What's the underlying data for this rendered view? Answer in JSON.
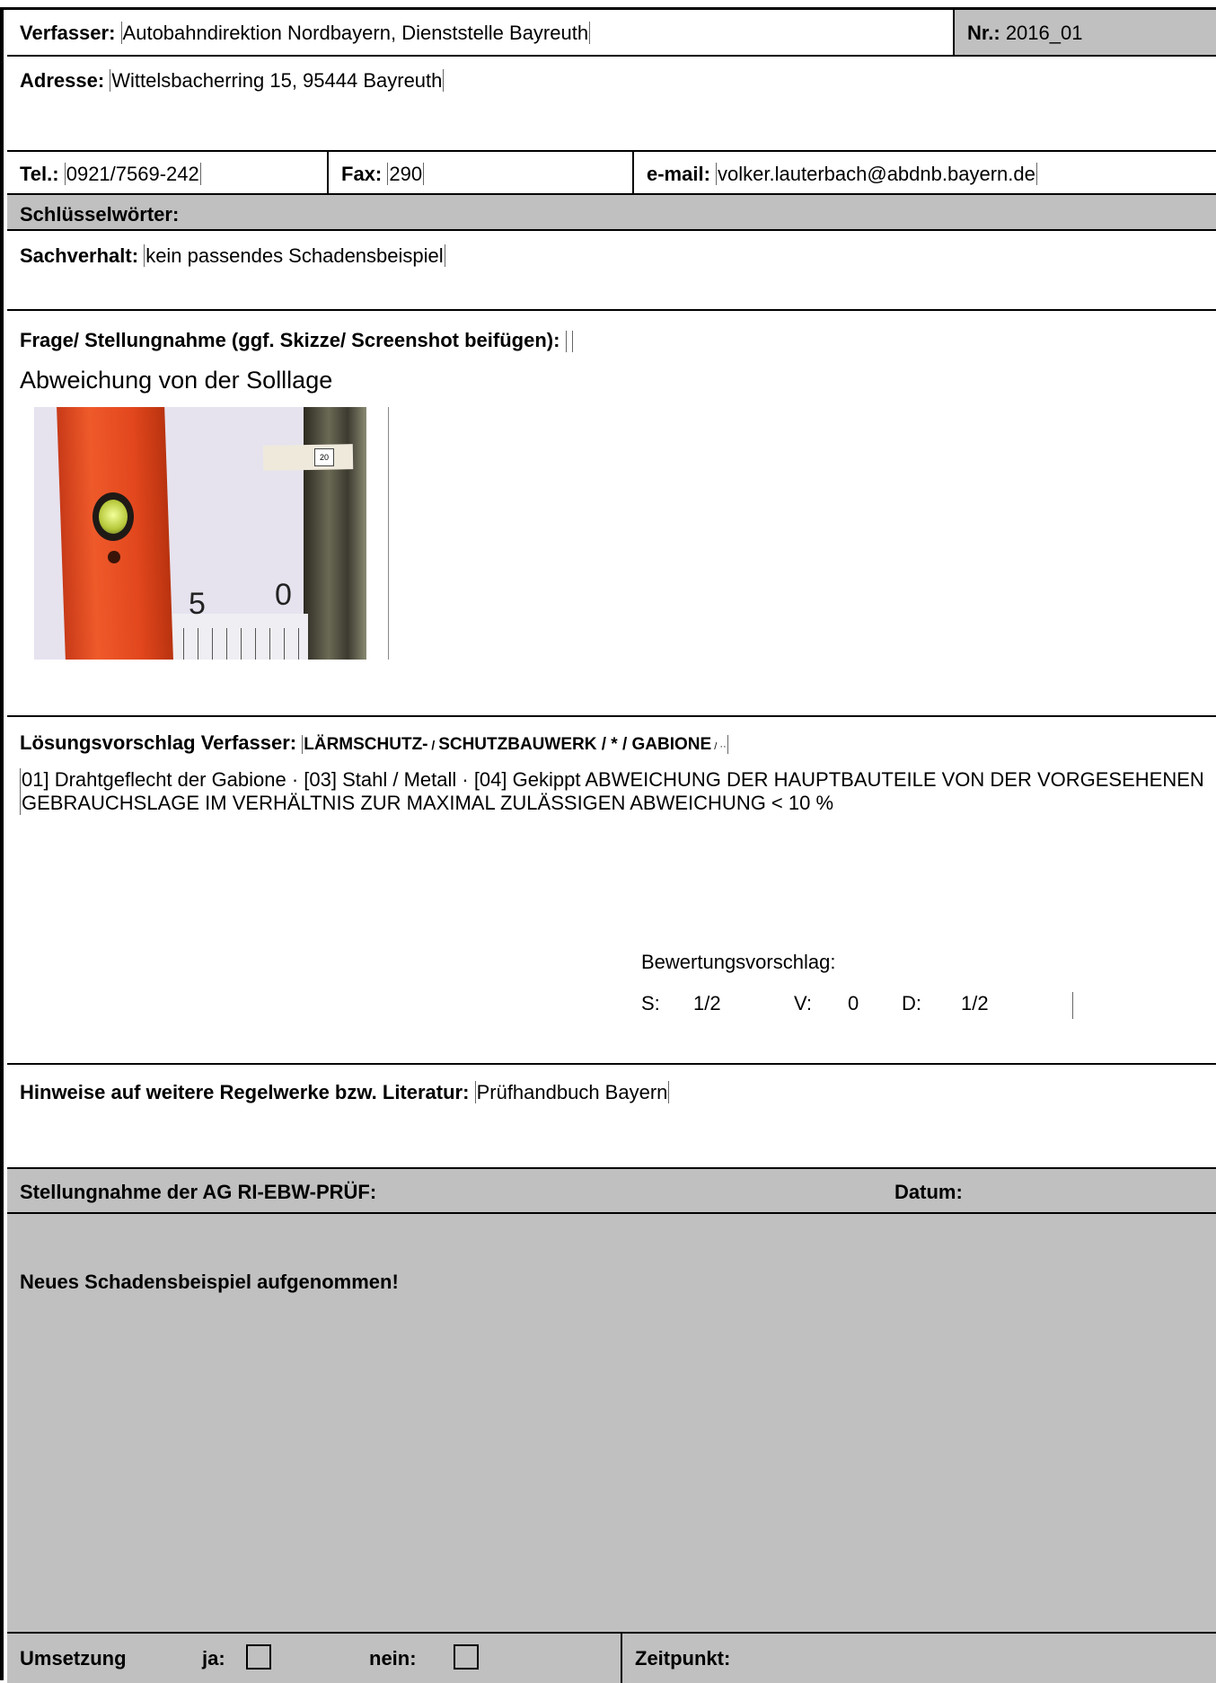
{
  "header": {
    "verfasser_label": "Verfasser:",
    "verfasser_value": "Autobahndirektion Nordbayern, Dienststelle Bayreuth",
    "nr_label": "Nr.:",
    "nr_value": "2016_01"
  },
  "adresse": {
    "label": "Adresse:",
    "value": "Wittelsbacherring 15, 95444 Bayreuth"
  },
  "contact": {
    "tel_label": "Tel.:",
    "tel_value": "0921/7569-242",
    "fax_label": "Fax:",
    "fax_value": "290",
    "email_label": "e-mail:",
    "email_value": "volker.lauterbach@abdnb.bayern.de"
  },
  "schluesselwoerter": {
    "label": "Schlüsselwörter:"
  },
  "sachverhalt": {
    "label": "Sachverhalt:",
    "value": "kein passendes Schadensbeispiel"
  },
  "frage": {
    "label": "Frage/ Stellungnahme (ggf. Skizze/ Screenshot beifügen):",
    "text": "Abweichung von der Solllage",
    "photo": {
      "tag": "20",
      "scale_left": "5",
      "scale_right": "0"
    }
  },
  "loesung": {
    "label": "Lösungsvorschlag Verfasser:",
    "value_big1": "LÄRMSCHUTZ-",
    "value_sep1": " / ",
    "value_big2": "SCHUTZBAUWERK / * / GABIONE",
    "value_sep2": " / ··",
    "body": "01] Drahtgeflecht der Gabione · [03] Stahl / Metall · [04] Gekippt ABWEICHUNG DER HAUPTBAUTEILE VON DER VORGESEHENEN GEBRAUCHSLAGE IM VERHÄLTNIS ZUR MAXIMAL ZULÄSSIGEN ABWEICHUNG < 10 %",
    "bewertung_label": "Bewertungsvorschlag:",
    "s_label": "S:",
    "s_value": "1/2",
    "v_label": "V:",
    "v_value": "0",
    "d_label": "D:",
    "d_value": "1/2"
  },
  "hinweise": {
    "label": "Hinweise auf weitere Regelwerke bzw. Literatur:",
    "value": "Prüfhandbuch Bayern"
  },
  "ag": {
    "label": "Stellungnahme der AG RI-EBW-PRÜF:",
    "datum_label": "Datum:",
    "statement": "Neues Schadensbeispiel aufgenommen!"
  },
  "umsetzung": {
    "label": "Umsetzung",
    "ja_label": "ja:",
    "nein_label": "nein:",
    "zeitpunkt_label": "Zeitpunkt:"
  }
}
